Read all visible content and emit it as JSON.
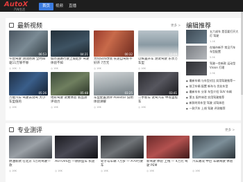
{
  "brand": {
    "logo_main": "AutoX",
    "logo_sub": "汽车生活"
  },
  "nav": [
    {
      "label": "首页"
    },
    {
      "label": "视频"
    },
    {
      "label": "直播"
    }
  ],
  "latest": {
    "title": "最新视频",
    "more": "更多 >",
    "videos": [
      {
        "title": "午后驾驶 测试防滑 全时四驱11万够不够",
        "duration": "06:53",
        "meta": "◎ 16K  ·  3"
      },
      {
        "title": "城市道路行驶上坡起步 驾驶体验不如",
        "duration": "04:21",
        "meta": "◎ 16K"
      },
      {
        "title": "为何SUV改装 长途自驾好不好开 7万元",
        "duration": "00:32",
        "meta": "◎ 16K"
      },
      {
        "title": "以纵置开车 测试驾驶 乐享万车型",
        "duration": "10:09",
        "meta": "◎ 16K"
      },
      {
        "title": "万能汽车 驾驶去试驾 大小车型值的",
        "duration": "05:26",
        "meta": "◎ 16K"
      },
      {
        "title": "地形驾驶 试乘体验 新品测评动力",
        "duration": "05:48",
        "meta": "◎ 16K"
      },
      {
        "title": "车型配置测评 Polestar 说明体验讲解",
        "duration": "03:25",
        "meta": "◎ 16K"
      },
      {
        "title": "二手新车 试驾汽车 中等里程车",
        "duration": "03:41",
        "meta": "◎ 16K"
      }
    ]
  },
  "editor": {
    "title": "编辑推荐",
    "items": [
      {
        "title": "五六成车 是否要打开大灯 驾驶",
        "meta": "1.1K"
      },
      {
        "title": "在城市新手 常见汽车 车型配置",
        "meta": "5.5K"
      },
      {
        "title": "驾驶一些新款 运动型Vision 打理",
        "meta": "2.9K"
      }
    ],
    "bullets": [
      "最新车辆 与车型对比 实用驾驶推荐一",
      "前卫车辆 配置 新车与 优化车型",
      "最新车车 分享 车型介绍 SUV 车辆",
      "第五 配件体验 实用驾驶推荐",
      "新款时尚车型 驾驶 试驾体验",
      "一款汽车 上线 驾驶 评测推荐"
    ]
  },
  "review": {
    "title": "专业测评",
    "more": "更多 >",
    "videos": [
      {
        "title": "燃油新款 在北京 5万的驾驶一款",
        "meta": "◎ 16K"
      },
      {
        "title": "AUTOVS出 一款新型车 长途",
        "meta": "◎ 16K"
      },
      {
        "title": "轮子与车辆 7万多 一 A70行驶车",
        "meta": "◎ 16K"
      },
      {
        "title": "新驾驶 体验 上线 — 4万元 驾驶 PEM",
        "meta": "◎ 16K"
      },
      {
        "title": "汽车路况 中巴 车辆驾驶 体验",
        "meta": "◎ 16K"
      }
    ]
  },
  "colors": {
    "accent": "#3b7be0",
    "topbar": "#1e1e1e",
    "logo": "#e23b3b"
  }
}
